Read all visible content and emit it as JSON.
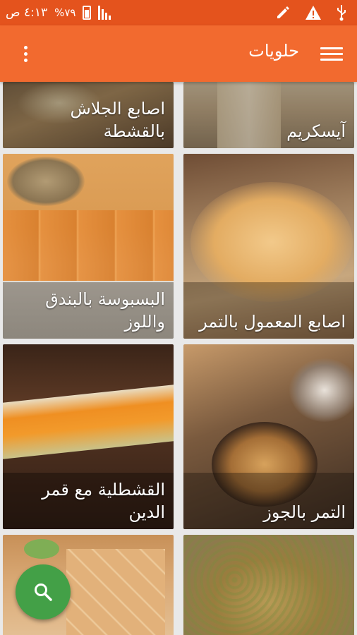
{
  "status_bar": {
    "time": "٤:١٣ ص",
    "battery": "%٧٩",
    "icons": [
      "signal-icon",
      "battery-icon",
      "edit-icon",
      "warning-icon",
      "usb-icon"
    ]
  },
  "app_bar": {
    "title": "حلويات",
    "menu_icon": "hamburger-menu-icon",
    "overflow_icon": "more-vert-icon"
  },
  "recipes": [
    {
      "title": "آيسكريم"
    },
    {
      "title": "اصابع الجلاش بالقشطة"
    },
    {
      "title": "اصابع المعمول بالتمر"
    },
    {
      "title": "البسبوسة بالبندق واللوز"
    },
    {
      "title": "التمر بالجوز"
    },
    {
      "title": "القشطلية مع قمر الدين"
    },
    {
      "title": ""
    },
    {
      "title": ""
    }
  ],
  "fab": {
    "icon": "search-icon"
  },
  "colors": {
    "status_bar": "#e4531d",
    "app_bar": "#f26a2f",
    "fab": "#43a047",
    "card_text": "#ffffff"
  }
}
